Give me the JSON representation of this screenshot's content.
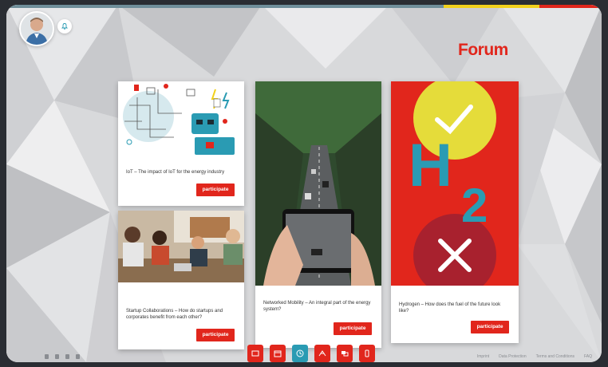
{
  "forum": {
    "title": "Forum"
  },
  "cards": [
    {
      "caption": "IoT – The impact of IoT for the energy industry",
      "button": "participate"
    },
    {
      "caption": "Startup Collaborations – How do startups and corporates benefit from each other?",
      "button": "participate"
    },
    {
      "caption": "Networked Mobility – An integral part of the energy system?",
      "button": "participate"
    },
    {
      "caption": "Hydrogen – How does the fuel of the future look like?",
      "button": "participate"
    }
  ],
  "hydrogen_graphic": {
    "letter": "H",
    "subscript": "2"
  },
  "footer": {
    "links": [
      "Imprint",
      "Data Protection",
      "Terms and Conditions",
      "FAQ"
    ]
  },
  "dock": {
    "icons": [
      "stage-icon",
      "calendar-icon",
      "clock-icon",
      "network-icon",
      "chat-icon",
      "mobile-icon"
    ],
    "active_index": 2
  },
  "colors": {
    "accent": "#e1261c",
    "teal": "#2a9bb3",
    "yellow": "#e5dc3a"
  }
}
